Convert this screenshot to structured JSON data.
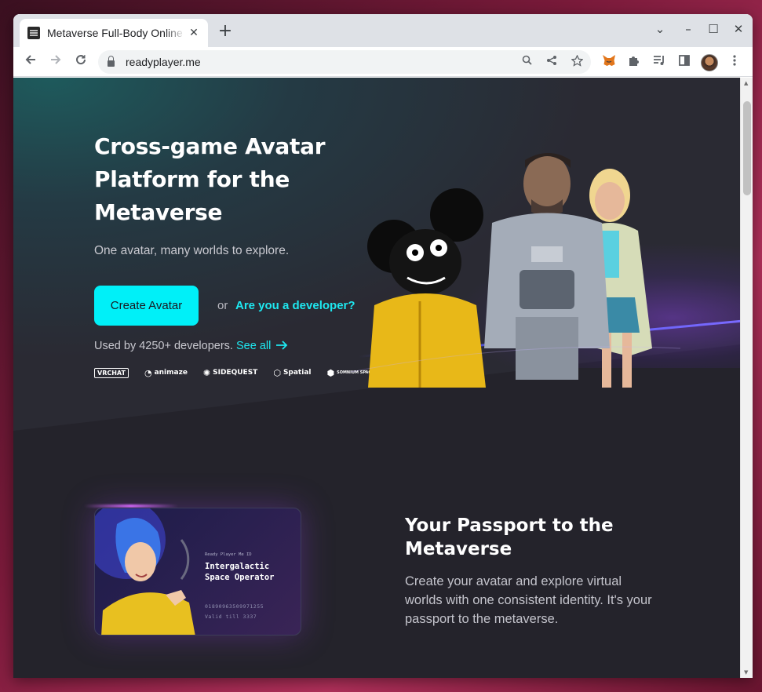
{
  "browser": {
    "tab_title": "Metaverse Full-Body Online Avatar",
    "tab_close": "✕",
    "new_tab": "+",
    "url": "readyplayer.me",
    "window_controls": {
      "dropdown": "⌄",
      "minimize": "–",
      "maximize": "☐",
      "close": "✕"
    }
  },
  "hero": {
    "title": "Cross-game Avatar Platform for the Metaverse",
    "subtitle": "One avatar, many worlds to explore.",
    "cta_label": "Create Avatar",
    "or_text": "or",
    "developer_link": "Are you a developer?",
    "used_by_text": "Used by 4250+ developers.",
    "see_all": "See all",
    "partners": [
      "VRCHAT",
      "animaze",
      "SIDEQUEST",
      "Spatial",
      "SOMNIUM SPACE"
    ]
  },
  "passport": {
    "title": "Your Passport to the Metaverse",
    "description": "Create your avatar and explore virtual worlds with one consistent identity. It's your passport to the metaverse.",
    "card_small": "Ready Player Me ID",
    "card_role": "Intergalactic Space Operator",
    "card_id": "01890963509971255",
    "card_valid": "Valid till 3337"
  },
  "colors": {
    "accent": "#00f0f8",
    "link": "#1ee8f0",
    "page_bg": "#24232b"
  }
}
